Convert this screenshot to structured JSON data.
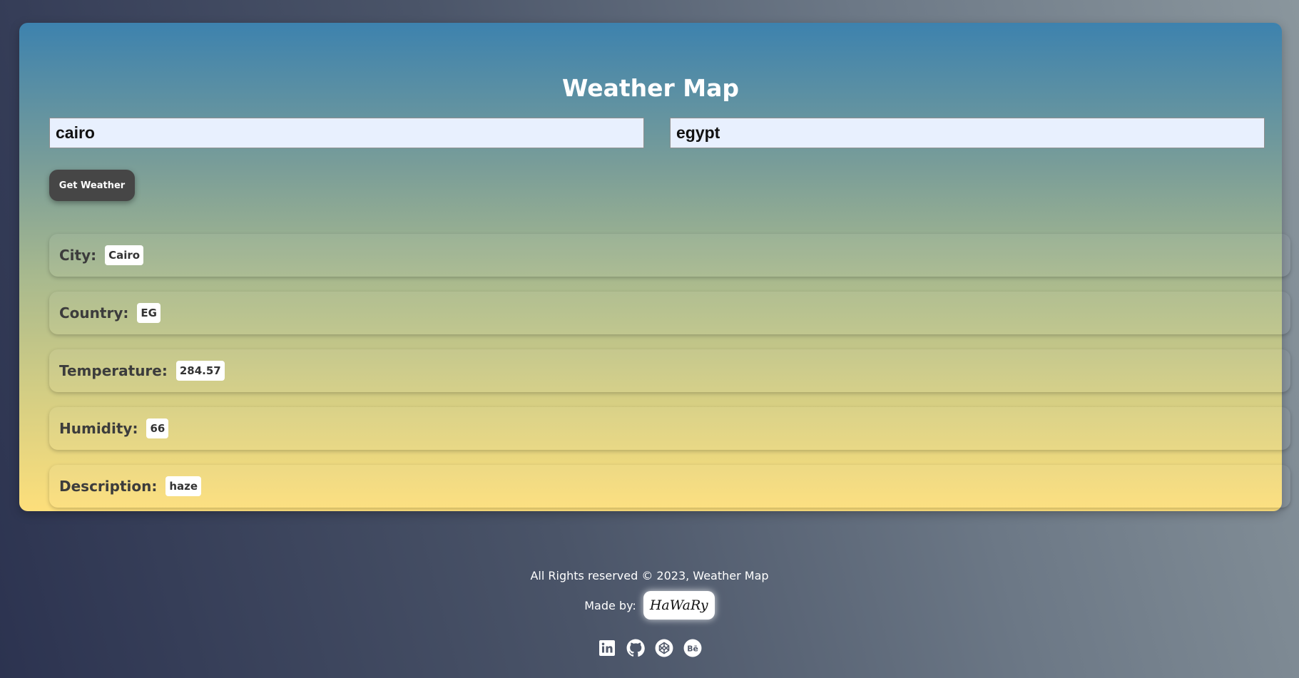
{
  "app": {
    "title": "Weather Map"
  },
  "form": {
    "city_value": "cairo",
    "country_value": "egypt",
    "submit_label": "Get Weather"
  },
  "results": [
    {
      "label": "City:",
      "value": "Cairo"
    },
    {
      "label": "Country:",
      "value": "EG"
    },
    {
      "label": "Temperature:",
      "value": "284.57"
    },
    {
      "label": "Humidity:",
      "value": "66"
    },
    {
      "label": "Description:",
      "value": "haze"
    }
  ],
  "footer": {
    "copyright": "All Rights reserved © 2023, Weather Map",
    "made_by_label": "Made by:",
    "author_logo_text": "HaWaRy",
    "socials": [
      "linkedin-icon",
      "github-icon",
      "codepen-icon",
      "behance-icon"
    ]
  }
}
